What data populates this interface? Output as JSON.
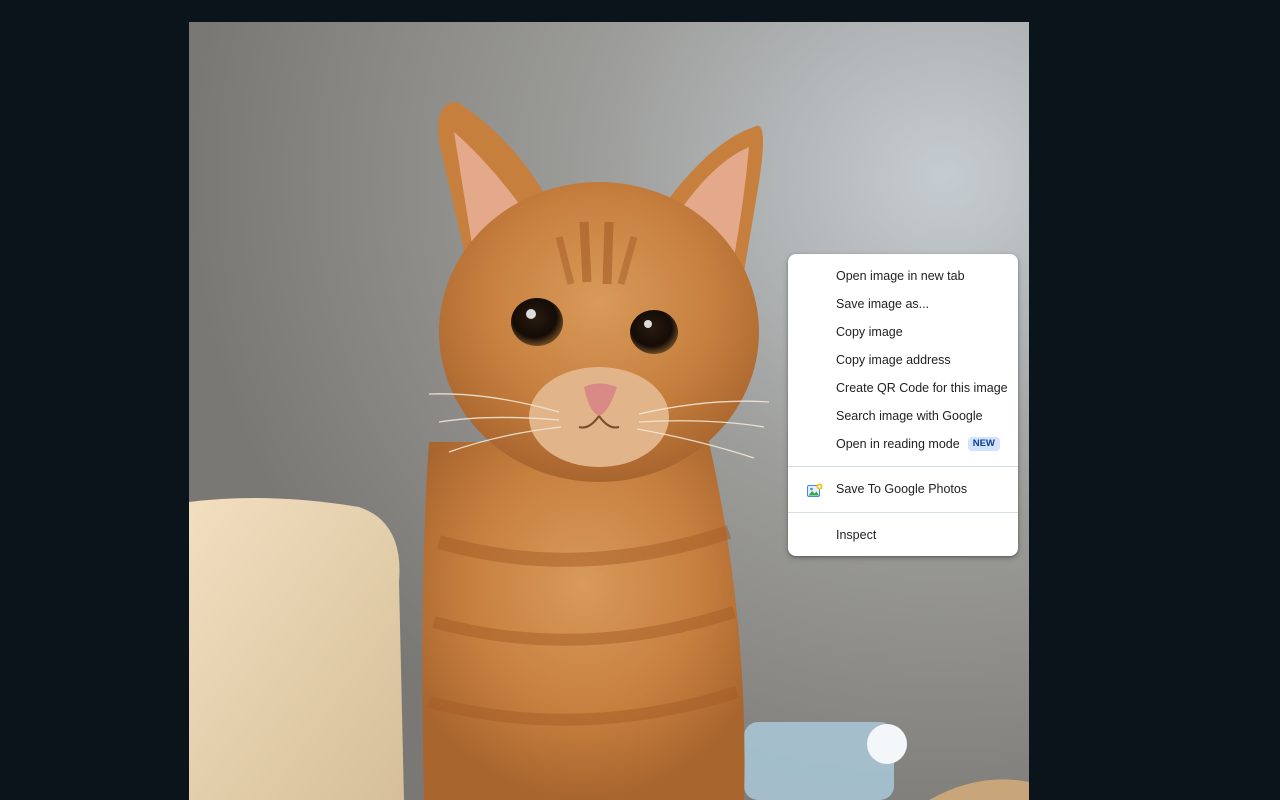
{
  "context_menu": {
    "items": [
      {
        "label": "Open image in new tab"
      },
      {
        "label": "Save image as..."
      },
      {
        "label": "Copy image"
      },
      {
        "label": "Copy image address"
      },
      {
        "label": "Create QR Code for this image"
      },
      {
        "label": "Search image with Google"
      },
      {
        "label": "Open in reading mode",
        "badge": "NEW"
      }
    ],
    "extension_item": {
      "label": "Save To Google Photos",
      "icon": "google-photos-icon"
    },
    "inspect_item": {
      "label": "Inspect"
    }
  },
  "colors": {
    "page_background": "#0b141a",
    "menu_background": "#ffffff",
    "badge_background": "#d3e3fd",
    "badge_text": "#0b3d91"
  }
}
